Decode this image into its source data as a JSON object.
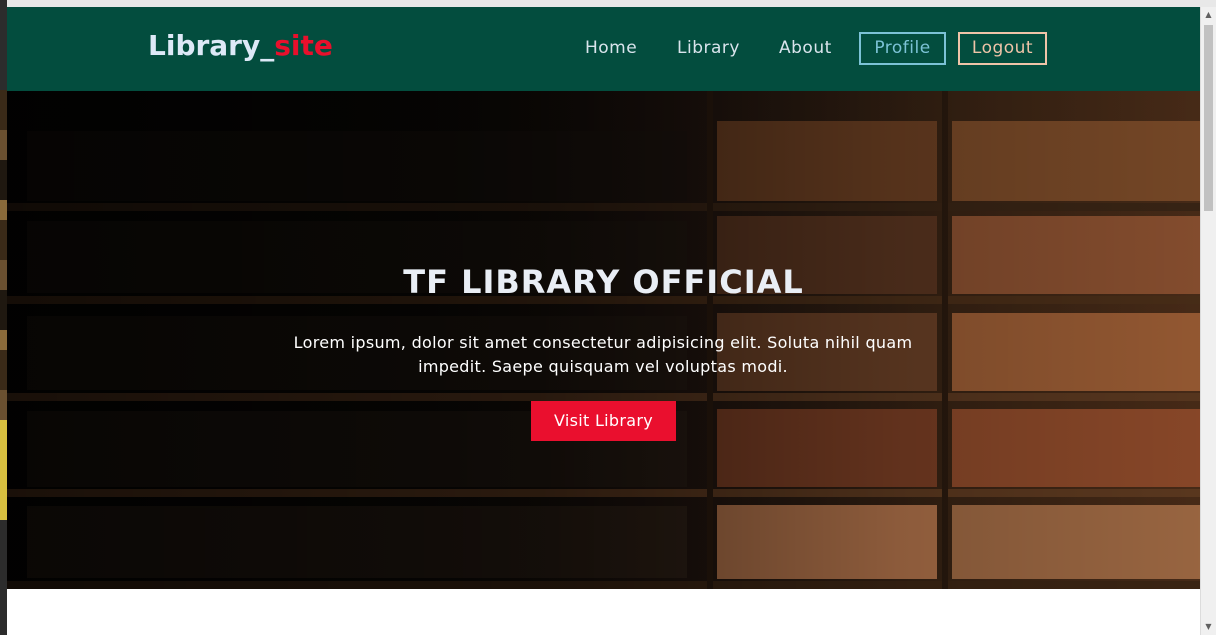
{
  "navbar": {
    "brand_part1": "Library_",
    "brand_part2": "site",
    "links": [
      "Home",
      "Library",
      "About"
    ],
    "profile_label": "Profile",
    "logout_label": "Logout"
  },
  "hero": {
    "title": "TF LIBRARY OFFICIAL",
    "text": "Lorem ipsum, dolor sit amet consectetur adipisicing elit. Soluta nihil quam impedit. Saepe quisquam vel voluptas modi.",
    "button_label": "Visit Library"
  },
  "colors": {
    "navbar_bg": "#034d3e",
    "brand_accent": "#e8102c",
    "profile_outline": "#7cc2d6",
    "logout_outline": "#efc4a8",
    "cta_bg": "#ea0f2e"
  },
  "icons": [
    "scroll-up-arrow-icon",
    "scroll-down-arrow-icon"
  ]
}
